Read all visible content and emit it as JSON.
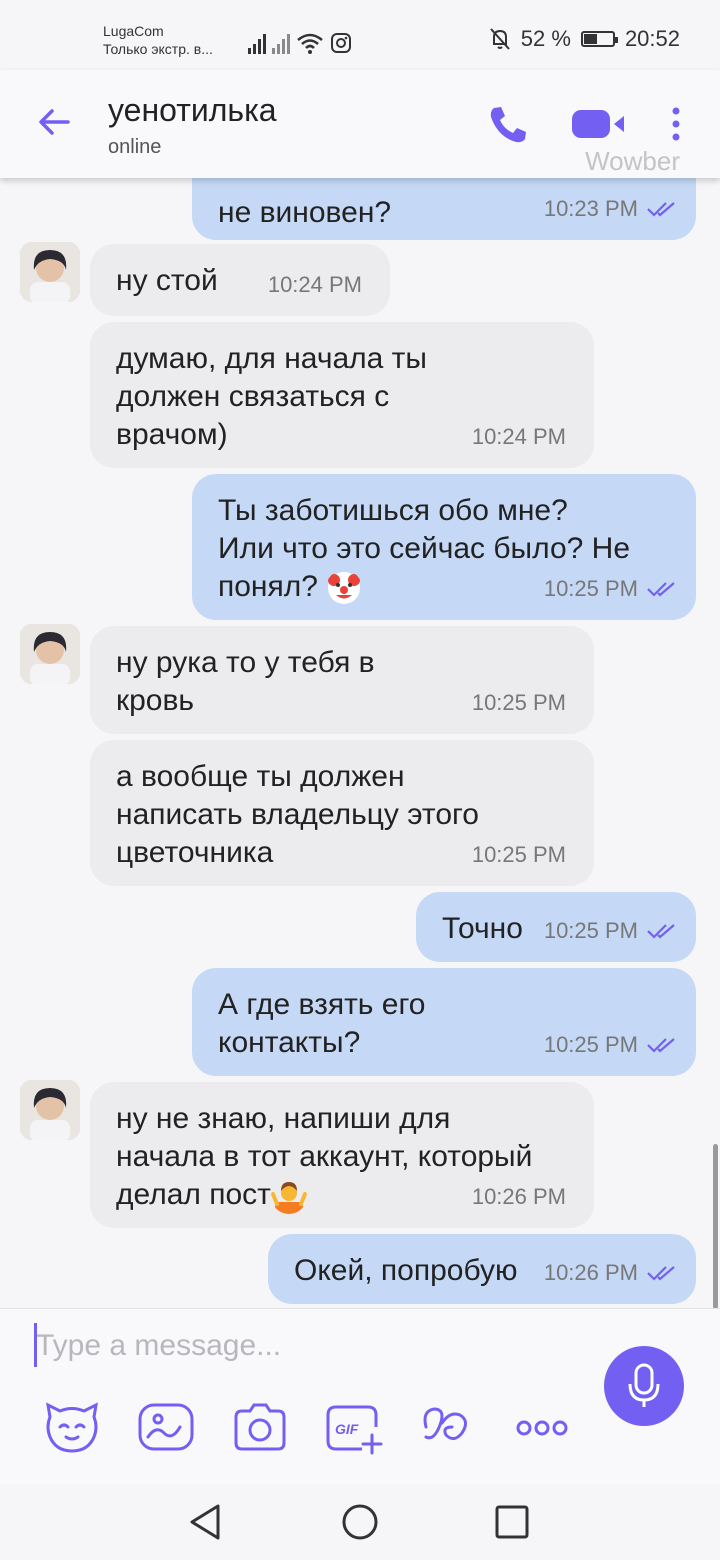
{
  "status_bar": {
    "carrier_name": "LugaCom",
    "carrier_status": "Только экстр. в...",
    "battery": "52 %",
    "battery_level": 0.52,
    "time": "20:52"
  },
  "header": {
    "contact_name": "уенотилька",
    "contact_status": "online",
    "watermark": "Wowber"
  },
  "messages": [
    {
      "id": "m1",
      "direction": "outgoing",
      "text": "не виновен?",
      "time": "10:23 PM",
      "read": true
    },
    {
      "id": "m2",
      "direction": "incoming",
      "text": "ну стой",
      "time": "10:24 PM"
    },
    {
      "id": "m3",
      "direction": "incoming",
      "text": "думаю, для начала ты\nдолжен связаться с\nврачом)",
      "time": "10:24 PM"
    },
    {
      "id": "m4",
      "direction": "outgoing",
      "text": "Ты заботишься обо мне?\nИли что это сейчас было? Не\nпонял? ",
      "emoji": "clown-face-emoji",
      "time": "10:25 PM",
      "read": true
    },
    {
      "id": "m5",
      "direction": "incoming",
      "text": "ну рука то у тебя в\nкровь",
      "time": "10:25 PM"
    },
    {
      "id": "m6",
      "direction": "incoming",
      "text": "а вообще ты должен\nнаписать владельцу этого\nцветочника",
      "time": "10:25 PM"
    },
    {
      "id": "m7",
      "direction": "outgoing",
      "text": "Точно",
      "time": "10:25 PM",
      "read": true
    },
    {
      "id": "m8",
      "direction": "outgoing",
      "text": "А где взять его\nконтакты?",
      "time": "10:25 PM",
      "read": true
    },
    {
      "id": "m9",
      "direction": "incoming",
      "text": "ну не знаю, напиши для\nначала в тот аккаунт, который\nделал пост",
      "emoji": "person-shrugging-emoji",
      "time": "10:26 PM"
    },
    {
      "id": "m10",
      "direction": "outgoing",
      "text": "Окей, попробую",
      "time": "10:26 PM",
      "read": true
    }
  ],
  "composer": {
    "placeholder": "Type a message...",
    "value": "",
    "tools": [
      "sticker-icon",
      "doodle-icon",
      "camera-icon",
      "gif-icon",
      "squiggle-icon",
      "more-dots-icon"
    ]
  },
  "colors": {
    "accent": "#7360f2",
    "outgoing_bubble": "#c5d9f6",
    "incoming_bubble": "#ececef",
    "read_ticks": "#7360f2"
  }
}
